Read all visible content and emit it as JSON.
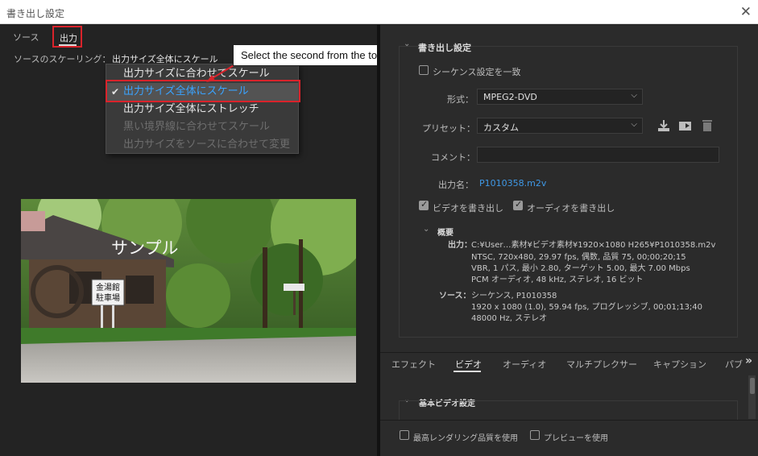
{
  "window": {
    "title": "書き出し設定",
    "close_icon": "close-icon"
  },
  "left_tabs": [
    {
      "label": "ソース"
    },
    {
      "label": "出力"
    }
  ],
  "scaling": {
    "label": "ソースのスケーリング：",
    "value": "出力サイズ全体にスケール",
    "options": [
      {
        "label": "出力サイズに合わせてスケール",
        "enabled": true,
        "selected": false
      },
      {
        "label": "出力サイズ全体にスケール",
        "enabled": true,
        "selected": true
      },
      {
        "label": "出力サイズ全体にストレッチ",
        "enabled": true,
        "selected": false
      },
      {
        "label": "黒い境界線に合わせてスケール",
        "enabled": false,
        "selected": false
      },
      {
        "label": "出力サイズをソースに合わせて変更",
        "enabled": false,
        "selected": false
      }
    ]
  },
  "callout": {
    "text": "Select the second from the top"
  },
  "preview": {
    "overlay_text": "サンプル",
    "sign_line1": "金湯館",
    "sign_line2": "駐車場"
  },
  "export": {
    "section_title": "書き出し設定",
    "sequence_match_label": "シーケンス設定を一致",
    "format_label": "形式：",
    "format_value": "MPEG2-DVD",
    "preset_label": "プリセット：",
    "preset_value": "カスタム",
    "comment_label": "コメント：",
    "comment_value": "",
    "output_name_label": "出力名：",
    "output_name_value": "P1010358.m2v",
    "export_video_label": "ビデオを書き出し",
    "export_audio_label": "オーディオを書き出し",
    "summary_title": "概要",
    "output_label": "出力：",
    "output_lines": [
      "C:¥User…素材¥ビデオ素材¥1920×1080 H265¥P1010358.m2v",
      "NTSC, 720x480, 29.97 fps, 偶数, 品質 75, 00;00;20;15",
      "VBR, 1 パス, 最小 2.80, ターゲット 5.00, 最大 7.00 Mbps",
      "PCM オーディオ, 48 kHz, ステレオ, 16 ビット"
    ],
    "source_label": "ソース：",
    "source_lines": [
      "シーケンス, P1010358",
      "1920 x 1080 (1.0), 59.94 fps, プログレッシブ, 00;01;13;40",
      "48000 Hz, ステレオ"
    ]
  },
  "bottom_tabs": [
    {
      "label": "エフェクト"
    },
    {
      "label": "ビデオ"
    },
    {
      "label": "オーディオ"
    },
    {
      "label": "マルチプレクサー"
    },
    {
      "label": "キャプション"
    },
    {
      "label": "パブ"
    }
  ],
  "tabs_overflow": "»",
  "video_section": {
    "title": "基本ビデオ設定"
  },
  "bottom_options": {
    "max_render_label": "最高レンダリング品質を使用",
    "use_preview_label": "プレビューを使用"
  },
  "colors": {
    "accent_red": "#d9232b",
    "link_blue": "#3f98e6",
    "selected_blue": "#3aa3ff"
  }
}
